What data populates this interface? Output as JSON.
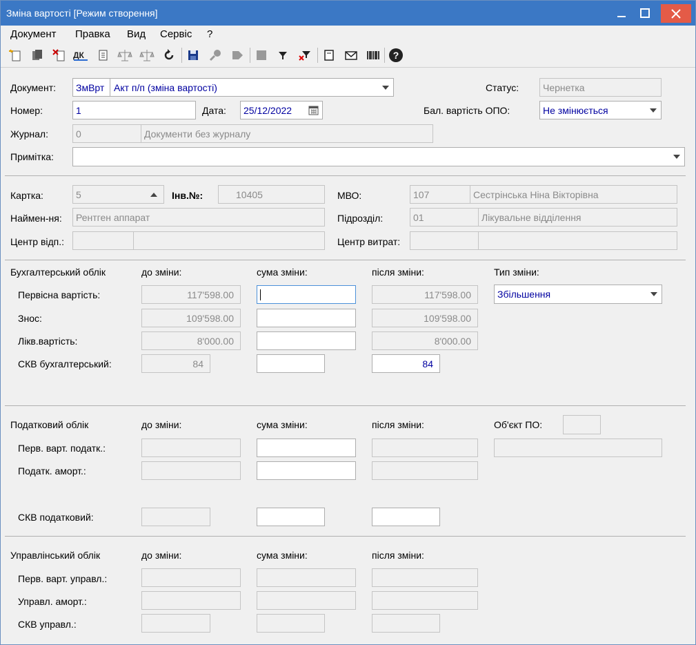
{
  "window": {
    "title": "Зміна вартості [Режим створення]"
  },
  "menu": [
    "Документ",
    "Правка",
    "Вид",
    "Сервіс",
    "?"
  ],
  "toolbar_icons": [
    "new-doc-icon",
    "copy-doc-icon",
    "delete-doc-icon",
    "dk-icon",
    "attach-icon",
    "scales-icon",
    "scales-down-icon",
    "refresh-icon",
    "save-icon",
    "key-icon",
    "forward-icon",
    "stop-icon",
    "filter-icon",
    "clear-filter-icon",
    "form-icon",
    "mail-icon",
    "barcode-icon",
    "help-icon"
  ],
  "header": {
    "doc_label": "Документ:",
    "doc_code": "ЗмВрт",
    "doc_type": "Акт п/п (зміна вартості)",
    "status_label": "Статус:",
    "status": "Чернетка",
    "number_label": "Номер:",
    "number": "1",
    "date_label": "Дата:",
    "date": "25/12/2022",
    "bal_label": "Бал. вартість ОПО:",
    "bal_value": "Не змінюється",
    "journal_label": "Журнал:",
    "journal_code": "0",
    "journal_name": "Документи без журналу",
    "note_label": "Примітка:",
    "note": ""
  },
  "card": {
    "card_label": "Картка:",
    "card": "5",
    "inv_label": "Інв.№:",
    "inv": "10405",
    "mvo_label": "МВО:",
    "mvo_code": "107",
    "mvo_name": "Сестрінська Ніна Вікторівна",
    "name_label": "Наймен-ня:",
    "name": "Рентген аппарат",
    "dept_label": "Підрозділ:",
    "dept_code": "01",
    "dept_name": "Лікувальне відділення",
    "resp_label": "Центр відп.:",
    "cost_label": "Центр витрат:"
  },
  "accounting": {
    "title": "Бухгалтерський облік",
    "before": "до зміни:",
    "change": "сума зміни:",
    "after": "після зміни:",
    "type_label": "Тип зміни:",
    "type_value": "Збільшення",
    "rows": [
      {
        "label": "Первісна вартість:",
        "before": "117'598.00",
        "change": "",
        "after": "117'598.00"
      },
      {
        "label": "Знос:",
        "before": "109'598.00",
        "change": "",
        "after": "109'598.00"
      },
      {
        "label": "Лікв.вартість:",
        "before": "8'000.00",
        "change": "",
        "after": "8'000.00"
      },
      {
        "label": "СКВ бухгалтерський:",
        "before": "84",
        "change": "",
        "after": "84"
      }
    ]
  },
  "tax": {
    "title": "Податковий облік",
    "before": "до зміни:",
    "change": "сума зміни:",
    "after": "після зміни:",
    "obj_label": "Об'єкт ПО:",
    "rows": [
      {
        "label": "Перв. варт. податк.:"
      },
      {
        "label": "Податк. аморт.:"
      },
      {
        "label": "СКВ податковий:"
      }
    ]
  },
  "mgmt": {
    "title": "Управлінський облік",
    "before": "до зміни:",
    "change": "сума зміни:",
    "after": "після зміни:",
    "rows": [
      {
        "label": "Перв. варт. управл.:"
      },
      {
        "label": "Управл. аморт.:"
      },
      {
        "label": "СКВ управл.:"
      }
    ]
  }
}
